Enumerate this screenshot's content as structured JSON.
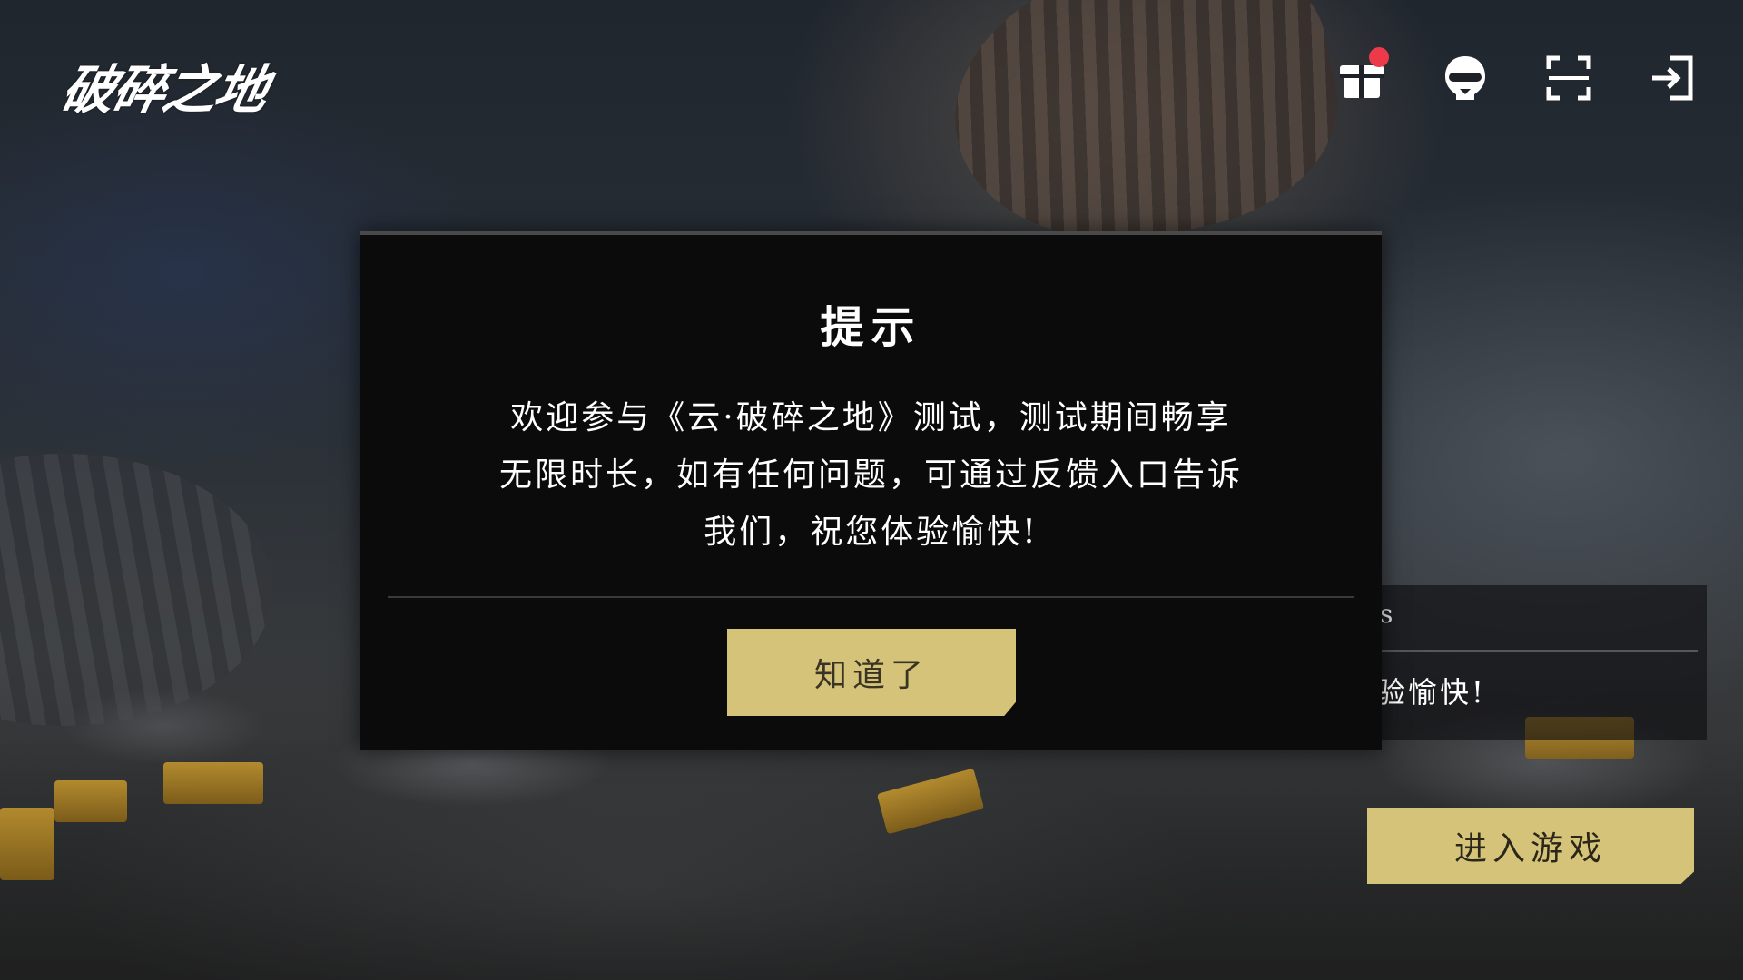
{
  "app": {
    "logo_text": "破碎之地"
  },
  "toolbar": {
    "icons": [
      {
        "name": "gift-icon",
        "has_notification": true
      },
      {
        "name": "customer-service-icon",
        "has_notification": false
      },
      {
        "name": "fullscreen-icon",
        "has_notification": false
      },
      {
        "name": "logout-icon",
        "has_notification": false
      }
    ],
    "notification_color": "#ec3a4a"
  },
  "background_panel": {
    "line1_partial": "s",
    "line2_partial": "验愉快!"
  },
  "enter_button": {
    "label": "进入游戏"
  },
  "dialog": {
    "title": "提示",
    "body_line1": "欢迎参与《云·破碎之地》测试，测试期间畅享",
    "body_line2": "无限时长，如有任何问题，可通过反馈入口告诉",
    "body_line3": "我们，祝您体验愉快!",
    "confirm_label": "知道了"
  },
  "colors": {
    "accent_gold": "#d6c37a",
    "dialog_bg": "#0b0b0c"
  }
}
